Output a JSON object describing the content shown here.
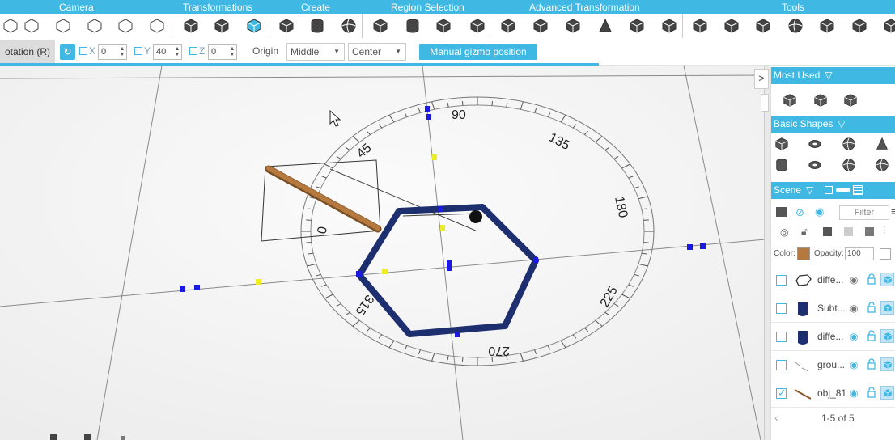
{
  "toolbar": {
    "categories": [
      {
        "label": "Camera"
      },
      {
        "label": "Transformations"
      },
      {
        "label": "Create"
      },
      {
        "label": "Region Selection"
      },
      {
        "label": "Advanced Transformation"
      },
      {
        "label": "Tools"
      }
    ],
    "icons": [
      "select-icon",
      "pointer-icon",
      "pan-icon",
      "rotate-view-icon",
      "zoom-icon",
      "frame-icon",
      "move-icon",
      "scale-icon",
      "rotate-icon",
      "box-create-icon",
      "cylinder-create-icon",
      "sphere-create-icon",
      "region-box-icon",
      "region-cylinder-icon",
      "region-select-icon",
      "region-cube-icon",
      "layers-icon",
      "subdivide-icon",
      "extrude-icon",
      "cone-icon",
      "twist-icon",
      "slice-icon",
      "measure-icon",
      "group-icon",
      "split-icon",
      "sphere-tool-icon",
      "cube-tool-icon",
      "grid-tool-icon",
      "hammer-icon"
    ]
  },
  "options": {
    "mode": "otation (R)",
    "x_label": "X",
    "x_value": "0",
    "y_label": "Y",
    "y_value": "40",
    "z_label": "Z",
    "z_value": "0",
    "origin_label": "Origin",
    "origin_value": "Middle",
    "center_value": "Center",
    "gizmo_button": "Manual gizmo position"
  },
  "viewport": {
    "dial_labels": [
      "90",
      "135",
      "180",
      "225",
      "270",
      "315",
      "0",
      "45"
    ],
    "accent_color": "#1d2f6f",
    "object_color": "#b5793f"
  },
  "panel": {
    "most_used": "Most Used",
    "basic_shapes": "Basic Shapes",
    "scene": "Scene",
    "filter_placeholder": "Filter",
    "color_label": "Color:",
    "opacity_label": "Opacity:",
    "opacity_value": "100",
    "scene_items": [
      {
        "name": "diffe...",
        "checked": false
      },
      {
        "name": "Subt...",
        "checked": false
      },
      {
        "name": "diffe...",
        "checked": false
      },
      {
        "name": "grou...",
        "checked": false
      },
      {
        "name": "obj_81",
        "checked": true
      }
    ],
    "pager_info": "1-5 of 5"
  }
}
